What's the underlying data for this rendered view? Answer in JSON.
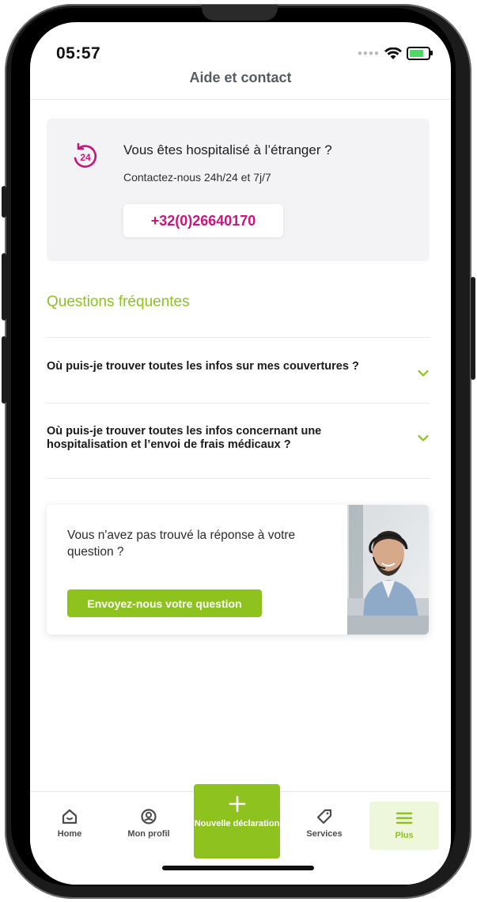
{
  "status_bar": {
    "time": "05:57"
  },
  "header": {
    "title": "Aide et contact"
  },
  "emergency": {
    "icon": "24h-icon",
    "title": "Vous êtes hospitalisé à l’étranger ?",
    "subtitle": "Contactez-nous 24h/24 et 7j/7",
    "phone": "+32(0)26640170",
    "icon_text": "24"
  },
  "faq": {
    "heading": "Questions fréquentes",
    "items": [
      {
        "question": "Où puis-je trouver toutes les infos sur mes couvertures ?"
      },
      {
        "question": "Où puis-je trouver toutes les infos concernant une hospitalisation et l’envoi de frais médicaux ?"
      }
    ]
  },
  "contact": {
    "text": "Vous n'avez pas trouvé la réponse à votre question ?",
    "button": "Envoyez-nous votre question"
  },
  "nav": {
    "home": "Home",
    "profile": "Mon profil",
    "new_declaration": "Nouvelle déclaration",
    "services": "Services",
    "more": "Plus"
  },
  "colors": {
    "accent_green": "#8dc21f",
    "brand_pink": "#c2187c"
  }
}
